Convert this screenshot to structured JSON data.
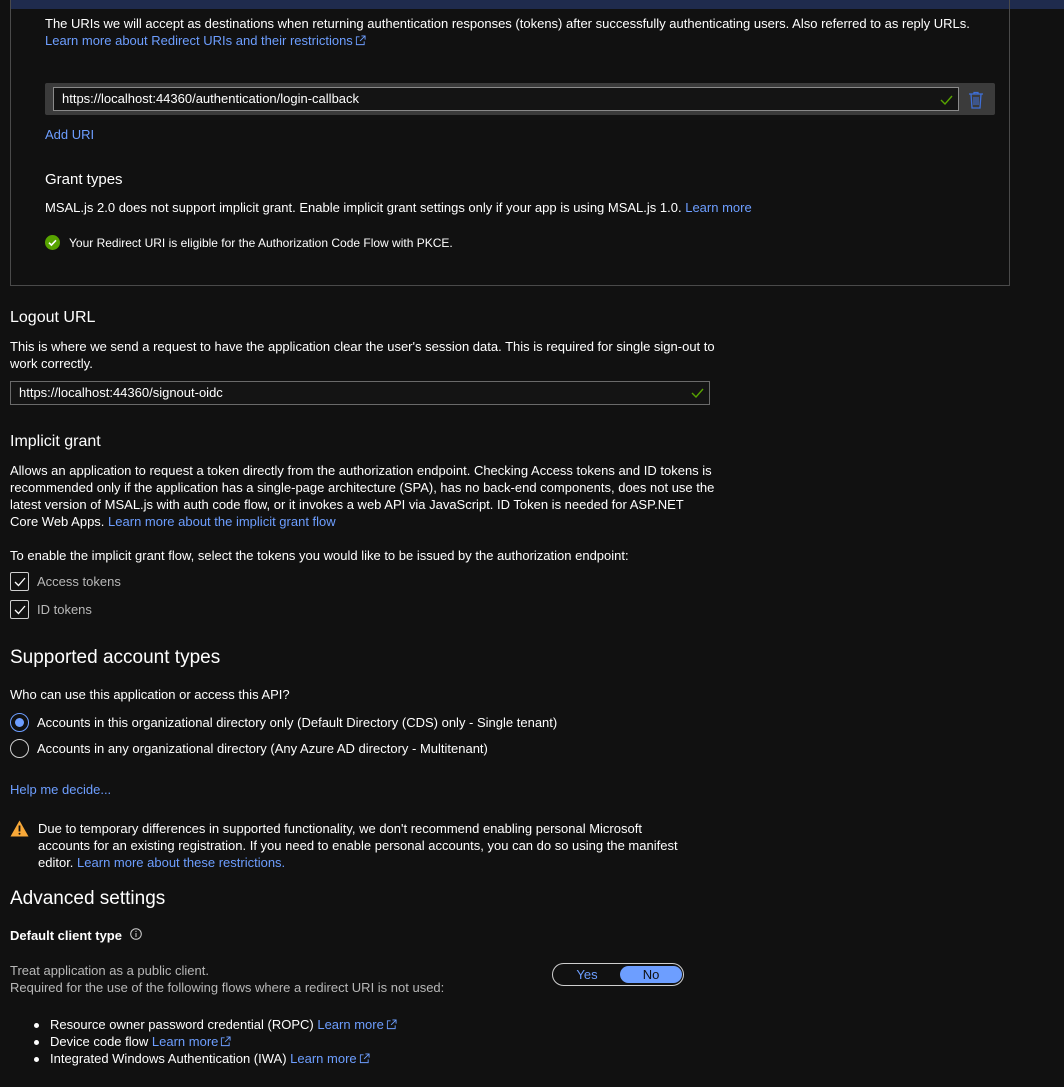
{
  "redirect": {
    "description": "The URIs we will accept as destinations when returning authentication responses (tokens) after successfully authenticating users. Also referred to as reply URLs.",
    "learn_link": "Learn more about Redirect URIs and their restrictions",
    "uri_value": "https://localhost:44360/authentication/login-callback",
    "add_uri": "Add URI"
  },
  "grant_types": {
    "heading": "Grant types",
    "description": "MSAL.js 2.0 does not support implicit grant. Enable implicit grant settings only if your app is using MSAL.js 1.0.",
    "learn_more": "Learn more",
    "eligible": "Your Redirect URI is eligible for the Authorization Code Flow with PKCE."
  },
  "logout": {
    "heading": "Logout URL",
    "description": "This is where we send a request to have the application clear the user's session data. This is required for single sign-out to work correctly.",
    "value": "https://localhost:44360/signout-oidc"
  },
  "implicit": {
    "heading": "Implicit grant",
    "description": "Allows an application to request a token directly from the authorization endpoint. Checking Access tokens and ID tokens is recommended only if the application has a single-page architecture (SPA), has no back-end components, does not use the latest version of MSAL.js with auth code flow, or it invokes a web API via JavaScript. ID Token is needed for ASP.NET Core Web Apps.",
    "learn_link": "Learn more about the implicit grant flow",
    "prompt": "To enable the implicit grant flow, select the tokens you would like to be issued by the authorization endpoint:",
    "access_tokens": "Access tokens",
    "id_tokens": "ID tokens"
  },
  "accounts": {
    "heading": "Supported account types",
    "question": "Who can use this application or access this API?",
    "option_single": "Accounts in this organizational directory only (Default Directory (CDS) only - Single tenant)",
    "option_multi": "Accounts in any organizational directory (Any Azure AD directory - Multitenant)",
    "selected": "single",
    "help": "Help me decide...",
    "warning": "Due to temporary differences in supported functionality, we don't recommend enabling personal Microsoft accounts for an existing registration. If you need to enable personal accounts, you can do so using the manifest editor.",
    "warning_link": "Learn more about these restrictions."
  },
  "advanced": {
    "heading": "Advanced settings",
    "client_type": "Default client type",
    "treat": "Treat application as a public client.",
    "required": "Required for the use of the following flows where a redirect URI is not used:",
    "toggle_yes": "Yes",
    "toggle_no": "No",
    "toggle_selected": "No",
    "flows": [
      {
        "label": "Resource owner password credential (ROPC)",
        "link": "Learn more"
      },
      {
        "label": "Device code flow",
        "link": "Learn more"
      },
      {
        "label": "Integrated Windows Authentication (IWA)",
        "link": "Learn more"
      }
    ]
  },
  "colors": {
    "background": "#111111",
    "link": "#6d9eff",
    "success": "#57a300",
    "warning": "#f8a838"
  }
}
